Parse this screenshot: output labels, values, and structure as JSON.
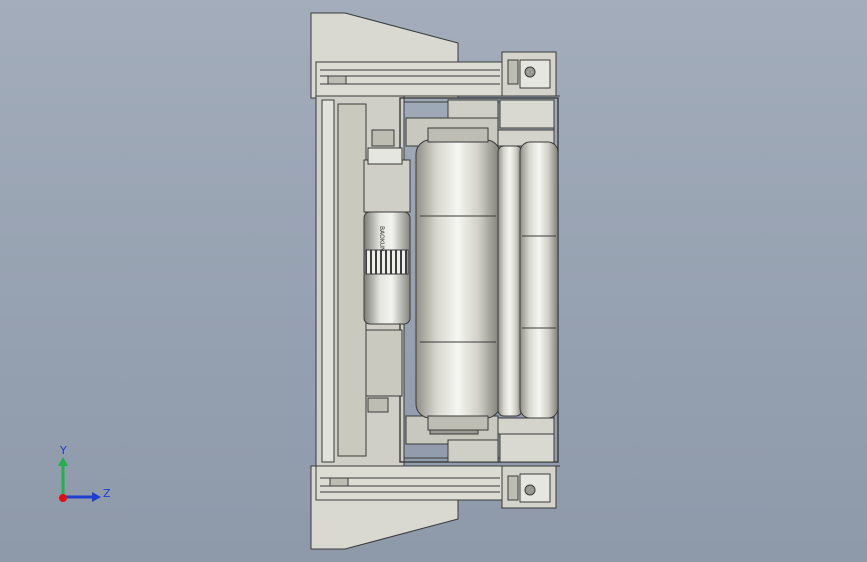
{
  "viewport": {
    "background_top": "#a3adbb",
    "background_bottom": "#8e99aa"
  },
  "model": {
    "part_fill": "#d9d9d1",
    "part_shade": "#bdbdb3",
    "edge": "#3a3a3a",
    "roller_highlight": "#f6f6f2",
    "motor_label": "BAOKUN"
  },
  "axis_triad": {
    "y_label": "Y",
    "z_label": "Z",
    "y_color": "#22b14c",
    "z_color": "#1f3fd1",
    "x_color": "#e01010"
  }
}
